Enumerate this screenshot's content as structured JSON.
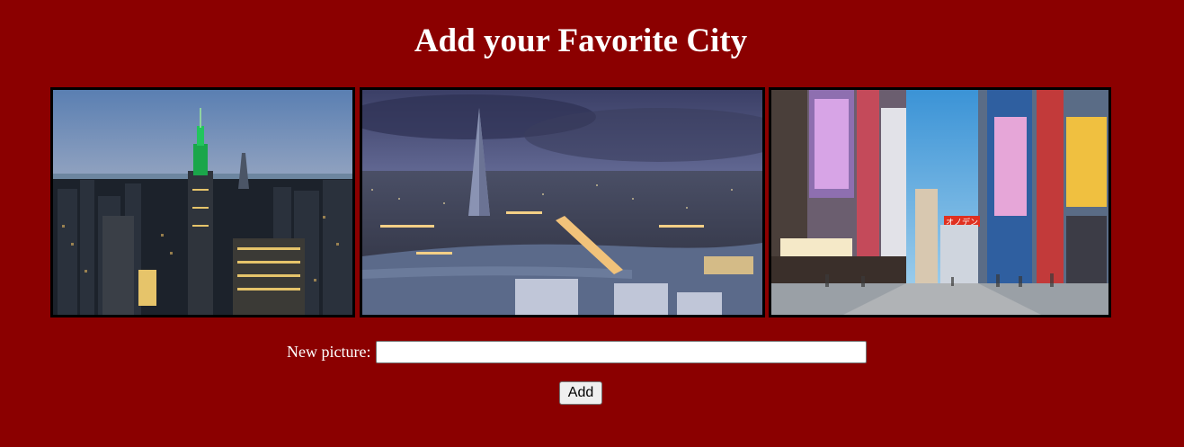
{
  "page": {
    "title": "Add your Favorite City",
    "background_color": "#8b0000"
  },
  "gallery": {
    "images": [
      {
        "name": "new-york-skyline",
        "alt": ""
      },
      {
        "name": "london-skyline",
        "alt": ""
      },
      {
        "name": "tokyo-akihabara-street",
        "alt": ""
      }
    ],
    "sign_text": "オノデン"
  },
  "form": {
    "label": "New picture:",
    "input_value": "",
    "input_placeholder": "",
    "button_label": "Add"
  }
}
